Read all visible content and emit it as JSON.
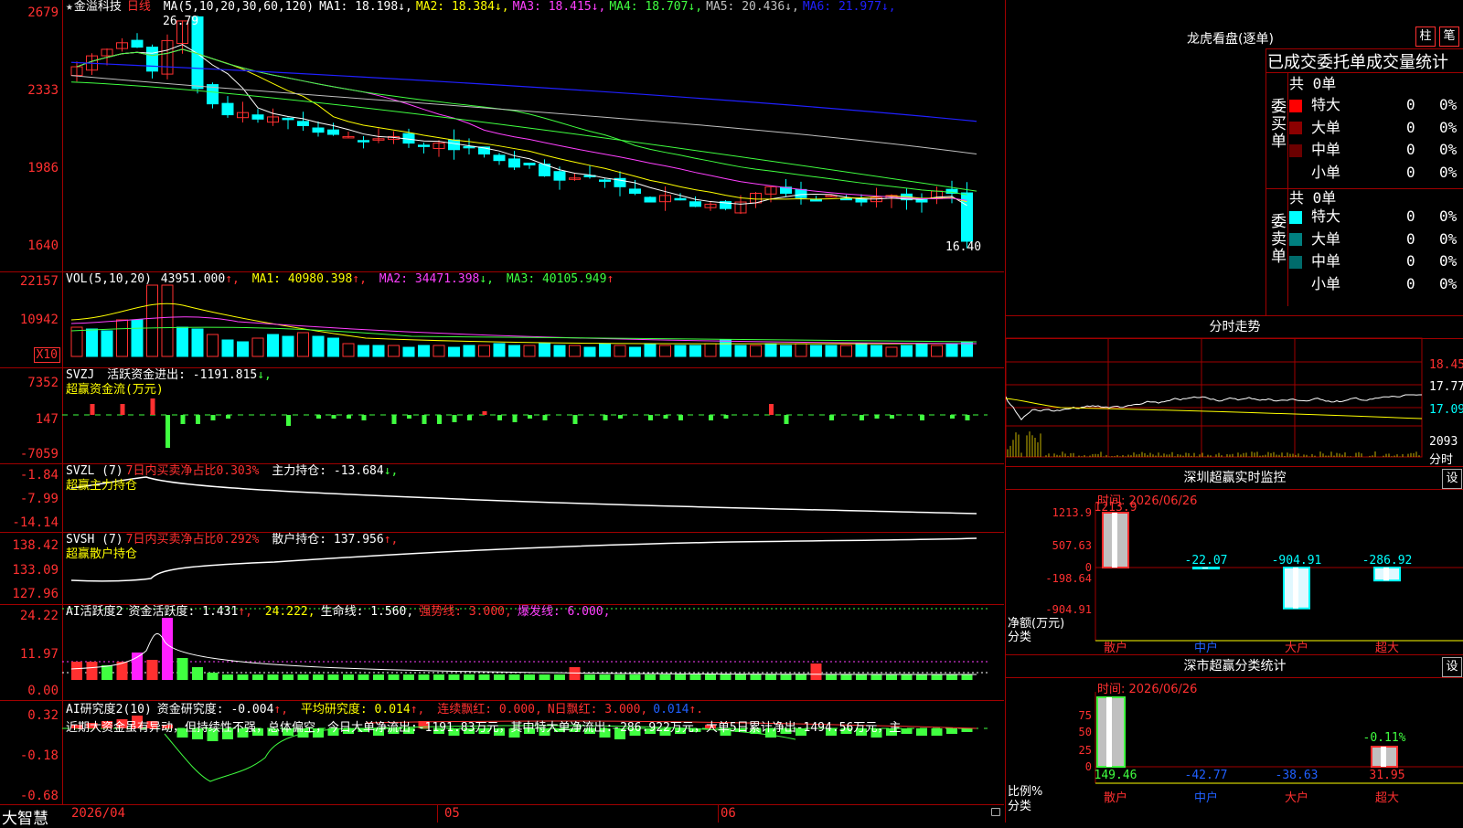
{
  "main_chart": {
    "title_star": "★",
    "stock_name": "金溢科技",
    "period": "日线",
    "ma_label": "MA(5,10,20,30,60,120)",
    "ma_values": [
      {
        "name": "MA1",
        "value": "18.198",
        "arrow": "↓",
        "color": "#ffffff"
      },
      {
        "name": "MA2",
        "value": "18.384",
        "arrow": "↓",
        "color": "#ffff00"
      },
      {
        "name": "MA3",
        "value": "18.415",
        "arrow": "↓",
        "color": "#ff40ff"
      },
      {
        "name": "MA4",
        "value": "18.707",
        "arrow": "↓",
        "color": "#40ff40"
      },
      {
        "name": "MA5",
        "value": "20.436",
        "arrow": "↓",
        "color": "#c0c0c0"
      },
      {
        "name": "MA6",
        "value": "21.977",
        "arrow": "↓",
        "color": "#2020ff"
      }
    ],
    "high_marker": "26.79",
    "low_marker": "16.40",
    "y_ticks": [
      "2679",
      "2333",
      "1986",
      "1640"
    ]
  },
  "vol_pane": {
    "label": "VOL(5,10,20)",
    "vol": "43951.000",
    "ma1": "40980.398",
    "ma2": "34471.398",
    "ma3": "40105.949",
    "y_ticks": [
      "22157",
      "10942"
    ],
    "unit_box": "X10"
  },
  "svzj_pane": {
    "label": "SVZJ",
    "line1": "活跃资金进出: -1191.815",
    "line1_arrow": "↓,",
    "subtitle": "超赢资金流(万元)",
    "y_ticks": [
      "7352",
      "147",
      "-7059"
    ]
  },
  "svzl_pane": {
    "label": "SVZL (7)",
    "text_red": "7日内买卖净占比0.303%",
    "text_white": "主力持仓: -13.684",
    "arrow": "↓,",
    "subtitle": "超赢主力持仓",
    "y_ticks": [
      "-1.84",
      "-7.99",
      "-14.14"
    ]
  },
  "svsh_pane": {
    "label": "SVSH (7)",
    "text_red": "7日内买卖净占比0.292%",
    "text_white": "散户持仓: 137.956",
    "arrow": "↑,",
    "subtitle": "超赢散户持仓",
    "y_ticks": [
      "138.42",
      "133.09",
      "127.96"
    ]
  },
  "ai_active_pane": {
    "label": "AI活跃度2",
    "t1": "资金活跃度: 1.431",
    "t2": "24.222,",
    "t3": "生命线: 1.560,",
    "t4": "强势线: 3.000,",
    "t5": "爆发线: 6.000,",
    "y_ticks": [
      "24.22",
      "11.97",
      "0.00"
    ]
  },
  "ai_research_pane": {
    "label": "AI研究度2(10)",
    "t1": "资金研究度: -0.004",
    "t2": "平均研究度: 0.014",
    "t3": "连续飘红: 0.000,",
    "t4": "N日飘红: 3.000,",
    "t5": "0.014",
    "comment": "近期大资金虽有异动，但持续性不强，总体偏空，今日大单净流出:-1191.83万元，其中特大单净流出:-286.922万元，大单5日累计净出-1494.56万元，主",
    "y_ticks": [
      "0.32",
      "-0.18",
      "-0.68"
    ]
  },
  "bottom_bar": {
    "brand": "大智慧",
    "date_start": "2026/04",
    "month1": "05",
    "month2": "06"
  },
  "dragon_tiger": {
    "title": "龙虎看盘(逐单)",
    "btn1": "柱",
    "btn2": "笔",
    "subtitle": "已成交委托单成交量统计",
    "buy_label": "委买单",
    "sell_label": "委卖单",
    "buy_total": "共 0单",
    "sell_total": "共 0单",
    "buy_rows": [
      {
        "name": "特大",
        "count": "0",
        "pct": "0%",
        "color": "#ff0000"
      },
      {
        "name": "大单",
        "count": "0",
        "pct": "0%",
        "color": "#8b0000"
      },
      {
        "name": "中单",
        "count": "0",
        "pct": "0%",
        "color": "#6b0000"
      },
      {
        "name": "小单",
        "count": "0",
        "pct": "0%",
        "color": "#000000"
      }
    ],
    "sell_rows": [
      {
        "name": "特大",
        "count": "0",
        "pct": "0%",
        "color": "#00ffff"
      },
      {
        "name": "大单",
        "count": "0",
        "pct": "0%",
        "color": "#008080"
      },
      {
        "name": "中单",
        "count": "0",
        "pct": "0%",
        "color": "#006b6b"
      },
      {
        "name": "小单",
        "count": "0",
        "pct": "0%",
        "color": "#000000"
      }
    ]
  },
  "intraday": {
    "title": "分时走势",
    "y_ticks": [
      "18.45",
      "17.77",
      "17.09"
    ],
    "vol_tick": "2093",
    "vol_label": "分时"
  },
  "sz_monitor": {
    "title": "深圳超赢实时监控",
    "btn": "设",
    "date": "时间: 2026/06/26",
    "y_ticks": [
      "1213.9",
      "507.63",
      "0",
      "-198.64",
      "-904.91"
    ],
    "y_axis_label": "净额(万元)",
    "cat_label": "分类",
    "categories": [
      "散户",
      "中户",
      "大户",
      "超大"
    ],
    "values": [
      "1213.9",
      "-22.07",
      "-904.91",
      "-286.92"
    ]
  },
  "sz_classify": {
    "title": "深市超赢分类统计",
    "btn": "设",
    "date": "时间: 2026/06/26",
    "y_ticks": [
      "75",
      "50",
      "25",
      "0"
    ],
    "y_axis_label": "比例%",
    "cat_label": "分类",
    "categories": [
      "散户",
      "中户",
      "大户",
      "超大"
    ],
    "values": [
      "149.46",
      "-42.77",
      "-38.63",
      "31.95"
    ],
    "mini_label": "-0.11%"
  },
  "colors": {
    "up": "#ff3030",
    "down": "#00ffff",
    "axis": "#a00000",
    "text_red": "#ff3030"
  }
}
